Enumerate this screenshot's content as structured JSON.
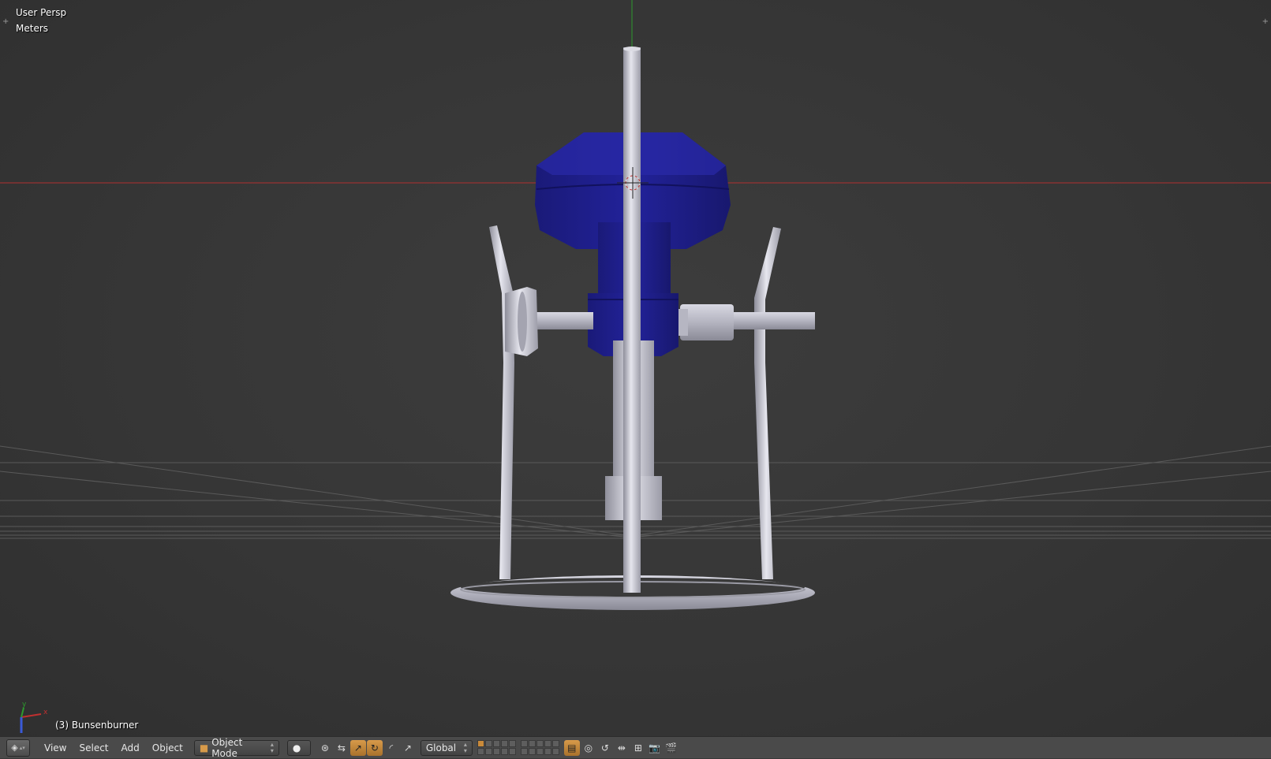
{
  "viewport": {
    "view_name": "User Persp",
    "units": "Meters",
    "active_object": "(3) Bunsenburner",
    "axis_x": "x",
    "axis_y": "y",
    "colors": {
      "background": "#393939",
      "blue_part": "#1e1e8c",
      "metal": "#c8c8d2",
      "x_axis": "#b03030",
      "y_axis": "#2e9a2e"
    }
  },
  "header": {
    "menu": {
      "view": "View",
      "select": "Select",
      "add": "Add",
      "object": "Object"
    },
    "mode": "Object Mode",
    "orientation": "Global",
    "icons": [
      "editor-type-icon",
      "shading-solid-icon",
      "pivot-icon",
      "manipulator-icon",
      "translate-icon",
      "rotate-icon",
      "scale-icon",
      "proportional-icon",
      "snap-icon",
      "render-icon"
    ]
  }
}
